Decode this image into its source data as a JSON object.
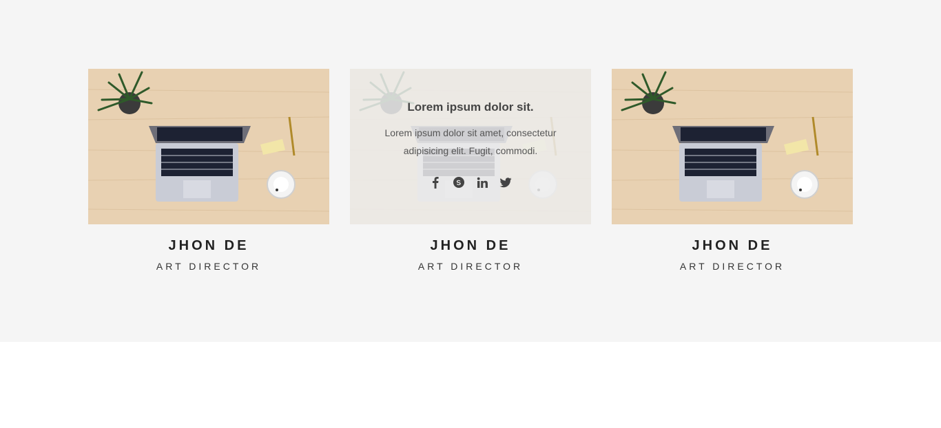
{
  "team": {
    "members": [
      {
        "name": "JHON DE",
        "role": "ART DIRECTOR"
      },
      {
        "name": "JHON DE",
        "role": "ART DIRECTOR",
        "hover": {
          "title": "Lorem ipsum dolor sit.",
          "text": "Lorem ipsum dolor sit amet, consectetur adipisicing elit. Fugit, commodi.",
          "social": [
            "facebook-icon",
            "skype-icon",
            "linkedin-icon",
            "twitter-icon"
          ]
        }
      },
      {
        "name": "JHON DE",
        "role": "ART DIRECTOR"
      }
    ]
  },
  "colors": {
    "section_bg": "#f5f5f5",
    "page_bg": "#ffffff",
    "name_text": "#222222",
    "overlay": "#ececec"
  }
}
